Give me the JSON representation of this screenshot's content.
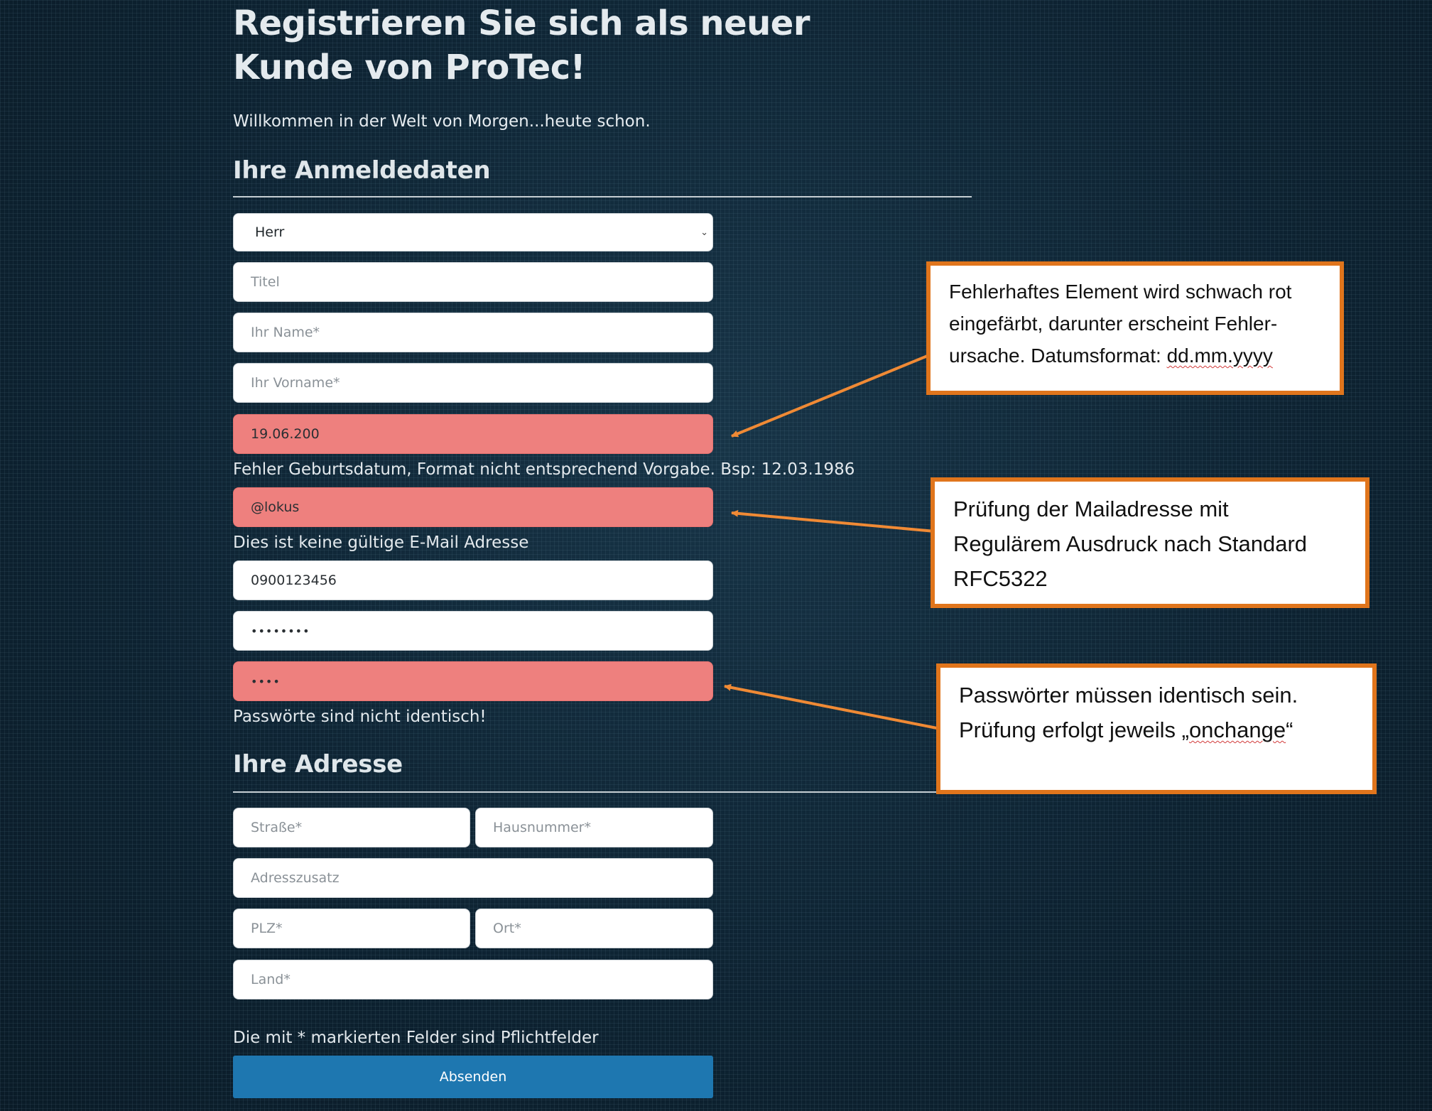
{
  "header": {
    "title": "Registrieren Sie sich als neuer Kunde von ProTec!",
    "subtitle": "Willkommen in der Welt von Morgen...heute schon."
  },
  "login_section": {
    "heading": "Ihre Anmeldedaten",
    "salutation_value": "Herr",
    "title_placeholder": "Titel",
    "name_placeholder": "Ihr Name*",
    "firstname_placeholder": "Ihr Vorname*",
    "birthdate_value": "19.06.200",
    "birthdate_error": "Fehler Geburtsdatum, Format nicht entsprechend Vorgabe. Bsp: 12.03.1986",
    "email_value": "@lokus",
    "email_error": "Dies ist keine gültige E-Mail Adresse",
    "phone_value": "0900123456",
    "password_value": "••••••••",
    "password_confirm_value": "••••",
    "password_error": "Passwörte sind nicht identisch!"
  },
  "address_section": {
    "heading": "Ihre Adresse",
    "street_placeholder": "Straße*",
    "housenumber_placeholder": "Hausnummer*",
    "addition_placeholder": "Adresszusatz",
    "zip_placeholder": "PLZ*",
    "city_placeholder": "Ort*",
    "country_placeholder": "Land*"
  },
  "footer": {
    "required_note": "Die mit * markierten Felder sind Pflichtfelder",
    "submit_label": "Absenden"
  },
  "callouts": {
    "error_field": {
      "line1": "Fehlerhaftes Element wird schwach rot",
      "line2": "eingefärbt, darunter erscheint Fehler-",
      "line3_prefix": "ursache. Datumsformat: ",
      "line3_format": "dd.mm.yyyy"
    },
    "mail_check": {
      "line1": "Prüfung der Mailadresse mit",
      "line2": "Regulärem Ausdruck nach Standard",
      "line3": "RFC5322"
    },
    "password_check": {
      "line1": "Passwörter müssen identisch sein.",
      "line2_prefix": "Prüfung erfolgt jeweils „",
      "line2_word": "onchange",
      "line2_suffix": "“"
    }
  },
  "colors": {
    "background": "#0f2535",
    "error_field": "#ee807e",
    "callout_border": "#e0751c",
    "arrow": "#f08a35",
    "submit_button": "#1e77b0"
  }
}
